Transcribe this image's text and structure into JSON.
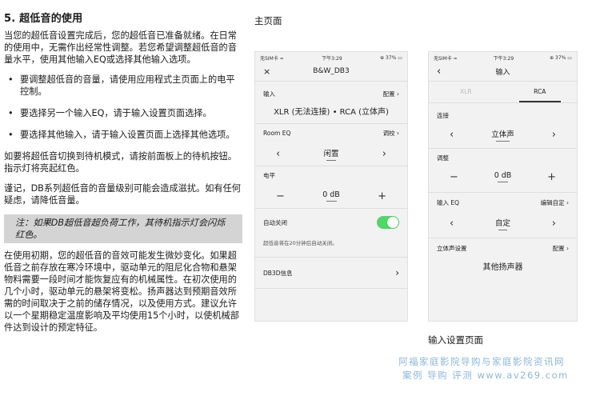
{
  "doc": {
    "heading": "5. 超低音的使用",
    "para1": "当您的超低音设置完成后，您的超低音已准备就绪。在日常的使用中，无需作出经常性调整。若您希望调整超低音的音量水平，使用其他输入EQ或选择其他输入选项。",
    "bullets": [
      "要调整超低音的音量，请使用应用程式主页面上的电平控制。",
      "要选择另一个输入EQ，请于输入设置页面选择。",
      "要选择其他输入，请于输入设置页面上选择其他选项。"
    ],
    "bullet_mark": "•",
    "para2": "如要将超低音切换到待机模式，请按前面板上的待机按钮。指示灯将亮起红色。",
    "para3": "谨记，DB系列超低音的音量级别可能会造成滋扰。如有任何疑虑，请降低音量。",
    "note": "注：如果DB超低音超负荷工作，其待机指示灯会闪烁红色。",
    "para4": "在使用初期，您的超低音的音效可能发生微妙变化。如果超低音之前存放在寒冷环境中，驱动单元的阻尼化合物和悬架物料需要一段时间才能恢复应有的机械属性。在初次使用的几个小时，驱动单元的悬架将变松。扬声器达到预期音效所需的时间取决于之前的储存情况，以及使用方式。建议允许以一个星期稳定温度影响及平均使用15个小时，以使机械部件达到设计的预定特征。"
  },
  "captions": {
    "main": "主页面",
    "input": "输入设置页面"
  },
  "phone1": {
    "status_left": "无SIM卡 ≈",
    "status_time": "下午3:29",
    "status_right": "⊕ 37% ▭",
    "close": "×",
    "title": "B&W_DB3",
    "input_label": "输入",
    "input_action": "配置 ›",
    "input_value": "XLR (无法连接) • RCA (立体声)",
    "roomeq_label": "Room EQ",
    "roomeq_action": "调校 ›",
    "roomeq_value": "闲置",
    "level_label": "电平",
    "level_value": "0 dB",
    "minus": "−",
    "plus": "+",
    "left_arrow": "‹",
    "right_arrow": "›",
    "autooff_label": "自动关闭",
    "autooff_desc": "超低音将在20分钟后自动关闭。",
    "info_label": "DB3D信息",
    "info_arrow": "›"
  },
  "phone2": {
    "status_left": "无SIM卡 ≈",
    "status_time": "下午3:29",
    "status_right": "⊕ 37% ▭",
    "back": "‹",
    "title": "输入",
    "tab_xlr": "XLR",
    "tab_rca": "RCA",
    "connect_label": "连接",
    "connect_value": "立体声",
    "adjust_label": "调整",
    "adjust_value": "0 dB",
    "inputeq_label": "输入 EQ",
    "inputeq_action": "编辑自定 ›",
    "inputeq_value": "自定",
    "stereo_label": "立体声设置",
    "stereo_action": "配置 ›",
    "stereo_value": "其他扬声器",
    "minus": "−",
    "plus": "+",
    "left_arrow": "‹",
    "right_arrow": "›"
  },
  "watermark": {
    "line1": "阿福家庭影院导购与家庭影院资讯网",
    "line2": "案例 导购 评测 www.av269.com"
  }
}
